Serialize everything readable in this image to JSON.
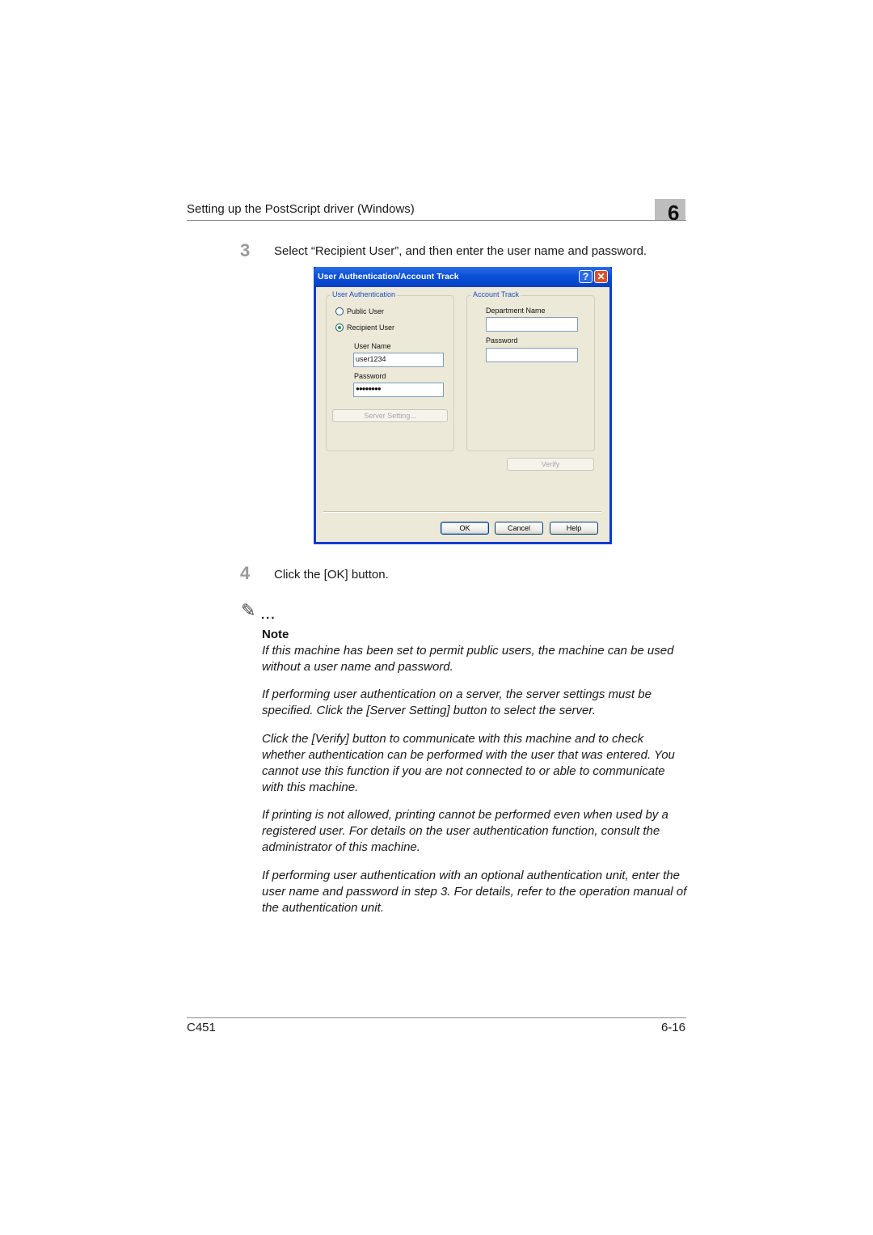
{
  "header": {
    "section_title": "Setting up the PostScript driver (Windows)",
    "chapter_number": "6"
  },
  "steps": [
    {
      "number": "3",
      "text": "Select “Recipient User”, and then enter the user name and password."
    },
    {
      "number": "4",
      "text": "Click the [OK] button."
    }
  ],
  "dialog": {
    "title": "User Authentication/Account Track",
    "help_icon": "question-mark-icon",
    "close_icon": "close-x-icon",
    "user_auth": {
      "group_label": "User Authentication",
      "public_user_label": "Public User",
      "recipient_user_label": "Recipient User",
      "selected": "Recipient User",
      "user_name_label": "User Name",
      "user_name_value": "user1234",
      "password_label": "Password",
      "password_value": "●●●●●●●●",
      "server_setting_button": "Server Setting..."
    },
    "account_track": {
      "group_label": "Account Track",
      "department_name_label": "Department Name",
      "department_name_value": "",
      "password_label": "Password",
      "password_value": ""
    },
    "verify_button": "Verify",
    "ok_button": "OK",
    "cancel_button": "Cancel",
    "help_button": "Help"
  },
  "note": {
    "icon": "pencil-note-icon",
    "dots": "...",
    "heading": "Note",
    "paragraphs": [
      "If this machine has been set to permit public users, the machine can be used without a user name and password.",
      "If performing user authentication on a server, the server settings must be specified. Click the [Server Setting] button to select the server.",
      "Click the [Verify] button to communicate with this machine and to check whether authentication can be performed with the user that was entered. You cannot use this function if you are not connected to or able to communicate with this machine.",
      "If printing is not allowed, printing cannot be performed even when used by a registered user. For details on the user authentication function, consult the administrator of this machine.",
      "If performing user authentication with an optional authentication unit, enter the user name and password in step 3. For details, refer to the operation manual of the authentication unit."
    ]
  },
  "footer": {
    "model": "C451",
    "page": "6-16"
  }
}
